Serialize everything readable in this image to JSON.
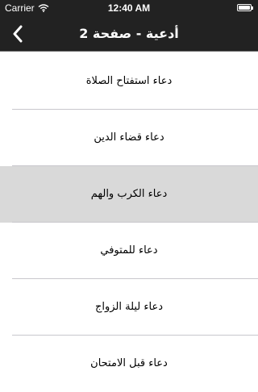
{
  "status_bar": {
    "carrier": "Carrier",
    "time": "12:40 AM",
    "icons": [
      "wifi-icon",
      "battery-icon"
    ]
  },
  "nav": {
    "title": "أدعية - صفحة 2",
    "back_icon": "chevron-left-icon"
  },
  "list": {
    "items": [
      {
        "label": "دعاء استفتاح الصلاة",
        "selected": false
      },
      {
        "label": "دعاء قضاء الدين",
        "selected": false
      },
      {
        "label": "دعاء الكرب والهم",
        "selected": true
      },
      {
        "label": "دعاء للمتوفي",
        "selected": false
      },
      {
        "label": "دعاء ليلة الزواج",
        "selected": false
      },
      {
        "label": "دعاء قبل الامتحان",
        "selected": false
      }
    ]
  },
  "colors": {
    "bar_background": "#222222",
    "bar_text": "#ffffff",
    "selected_row": "#d9d9d9",
    "separator": "#c8c7cc",
    "row_text": "#000000"
  }
}
